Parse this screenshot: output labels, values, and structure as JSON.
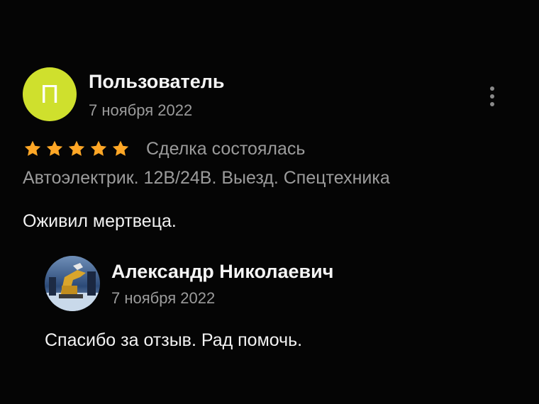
{
  "review": {
    "avatar_letter": "П",
    "avatar_color": "#cfe02d",
    "author": "Пользователь",
    "date": "7 ноября 2022",
    "rating": 5,
    "rating_max": 5,
    "star_color": "#ffa726",
    "deal_status": "Сделка состоялась",
    "ad_title": "Автоэлектрик. 12В/24В. Выезд. Спецтехника",
    "text": "Оживил мертвеца."
  },
  "reply": {
    "author": "Александр Николаевич",
    "date": "7 ноября 2022",
    "text": "Спасибо за отзыв. Рад помочь."
  }
}
